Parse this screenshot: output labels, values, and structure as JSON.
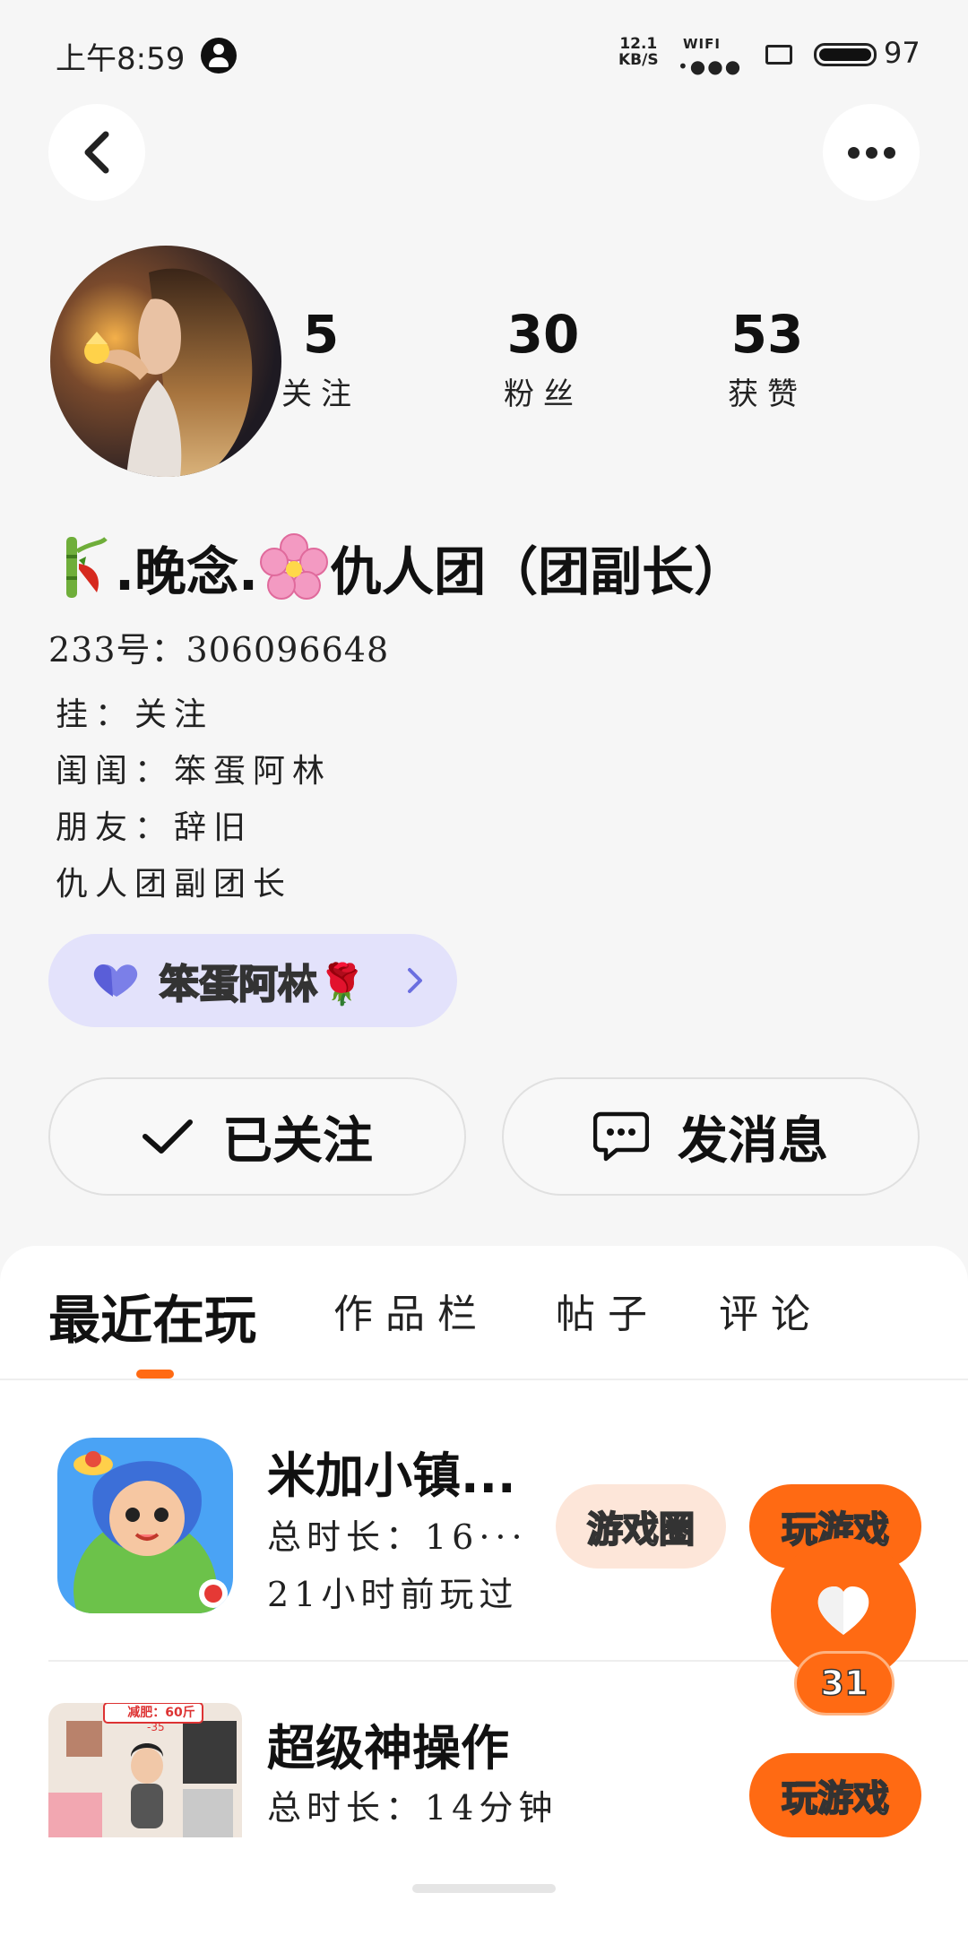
{
  "status_bar": {
    "time": "上午8:59",
    "net_speed_value": "12.1",
    "net_speed_unit": "KB/S",
    "wifi_label": "WIFI",
    "battery": "97"
  },
  "profile": {
    "stats": [
      {
        "value": "5",
        "label": "关注"
      },
      {
        "value": "30",
        "label": "粉丝"
      },
      {
        "value": "53",
        "label": "获赞"
      }
    ],
    "name_part1": ".晚念.",
    "name_part2": "仇人团（团副长）",
    "id_line": "233号：306096648",
    "bio_lines": [
      "挂：关注",
      "闺闺：笨蛋阿林",
      "朋友：辞旧",
      "仇人团副团长"
    ],
    "tag_label": "笨蛋阿林🌹"
  },
  "actions": {
    "follow_label": "已关注",
    "message_label": "发消息"
  },
  "tabs": [
    "最近在玩",
    "作品栏",
    "帖子",
    "评论"
  ],
  "games": [
    {
      "title": "米加小镇...",
      "duration": "总时长：16···",
      "last_played": "21小时前玩过",
      "circle_label": "游戏圈",
      "play_label": "玩游戏"
    },
    {
      "title": "超级神操作",
      "duration": "总时长：14分钟",
      "play_label": "玩游戏",
      "banner": "减肥：60斤",
      "banner_sub": "-35"
    }
  ],
  "like_fab": {
    "count": "31"
  },
  "colors": {
    "accent": "#ff6a13",
    "chip_bg": "#e3e2fb",
    "circle_chip_bg": "#fde6d9"
  }
}
